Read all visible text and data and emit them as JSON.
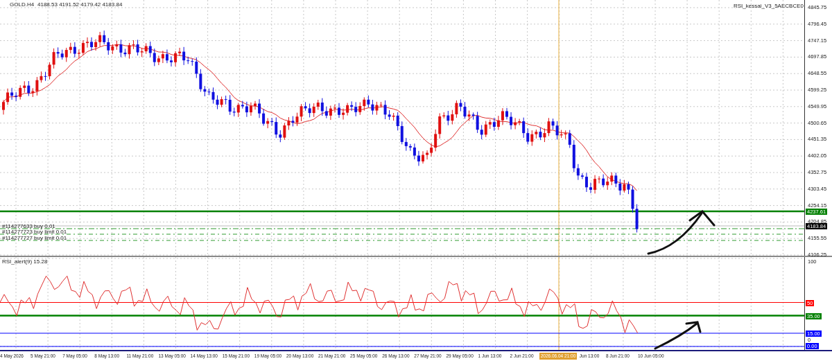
{
  "main_panel": {
    "symbol": "GOLD.H4",
    "ohlc": "4188.53 4191.52 4179.42 4183.84",
    "expert": "RSI_kessai_V3_5AECBCE0",
    "price_ticks": [
      "4845.75",
      "4796.45",
      "4747.15",
      "4697.85",
      "4648.55",
      "4599.25",
      "4549.95",
      "4500.65",
      "4451.35",
      "4402.05",
      "4352.75",
      "4303.45",
      "4254.15",
      "4204.85",
      "4155.55",
      "4106.25"
    ],
    "price_markers": [
      {
        "text": "4237.61",
        "kind": "line",
        "color": "#008000"
      },
      {
        "text": "4183.84",
        "kind": "bid",
        "color": "#000000"
      }
    ],
    "orders": [
      {
        "text": "#114277633 buy 0.01",
        "kind": "position"
      },
      {
        "text": "#114277723 buy limit 0.01",
        "kind": "pending"
      },
      {
        "text": "#114277727 buy limit 0.01",
        "kind": "pending"
      }
    ]
  },
  "rsi_panel": {
    "caption": "RSI_alert(9) 15.28",
    "scale_labels": [
      "100",
      "0"
    ],
    "level_markers": [
      {
        "text": "50",
        "color": "#ff0000"
      },
      {
        "text": "35.00",
        "color": "#008000"
      },
      {
        "text": "15.00",
        "color": "#0000ff"
      },
      {
        "text": "0.00",
        "color": "#0000ff"
      }
    ]
  },
  "time_axis": {
    "labels": [
      {
        "text": "4 May 2026",
        "selected": false
      },
      {
        "text": "5 May 21:00",
        "selected": false
      },
      {
        "text": "7 May 05:00",
        "selected": false
      },
      {
        "text": "8 May 13:00",
        "selected": false
      },
      {
        "text": "11 May 21:00",
        "selected": false
      },
      {
        "text": "13 May 05:00",
        "selected": false
      },
      {
        "text": "14 May 13:00",
        "selected": false
      },
      {
        "text": "15 May 21:00",
        "selected": false
      },
      {
        "text": "19 May 05:00",
        "selected": false
      },
      {
        "text": "20 May 13:00",
        "selected": false
      },
      {
        "text": "21 May 21:00",
        "selected": false
      },
      {
        "text": "25 May 05:00",
        "selected": false
      },
      {
        "text": "26 May 13:00",
        "selected": false
      },
      {
        "text": "27 May 21:00",
        "selected": false
      },
      {
        "text": "29 May 05:00",
        "selected": false
      },
      {
        "text": "1 Jun 13:00",
        "selected": false
      },
      {
        "text": "2 Jun 21:00",
        "selected": false
      },
      {
        "text": "2026.06.04 21:00",
        "selected": true
      },
      {
        "text": "Jun 13:00",
        "selected": false
      },
      {
        "text": "8 Jun 21:00",
        "selected": false
      },
      {
        "text": "10 Jun 05:00",
        "selected": false
      }
    ]
  }
}
